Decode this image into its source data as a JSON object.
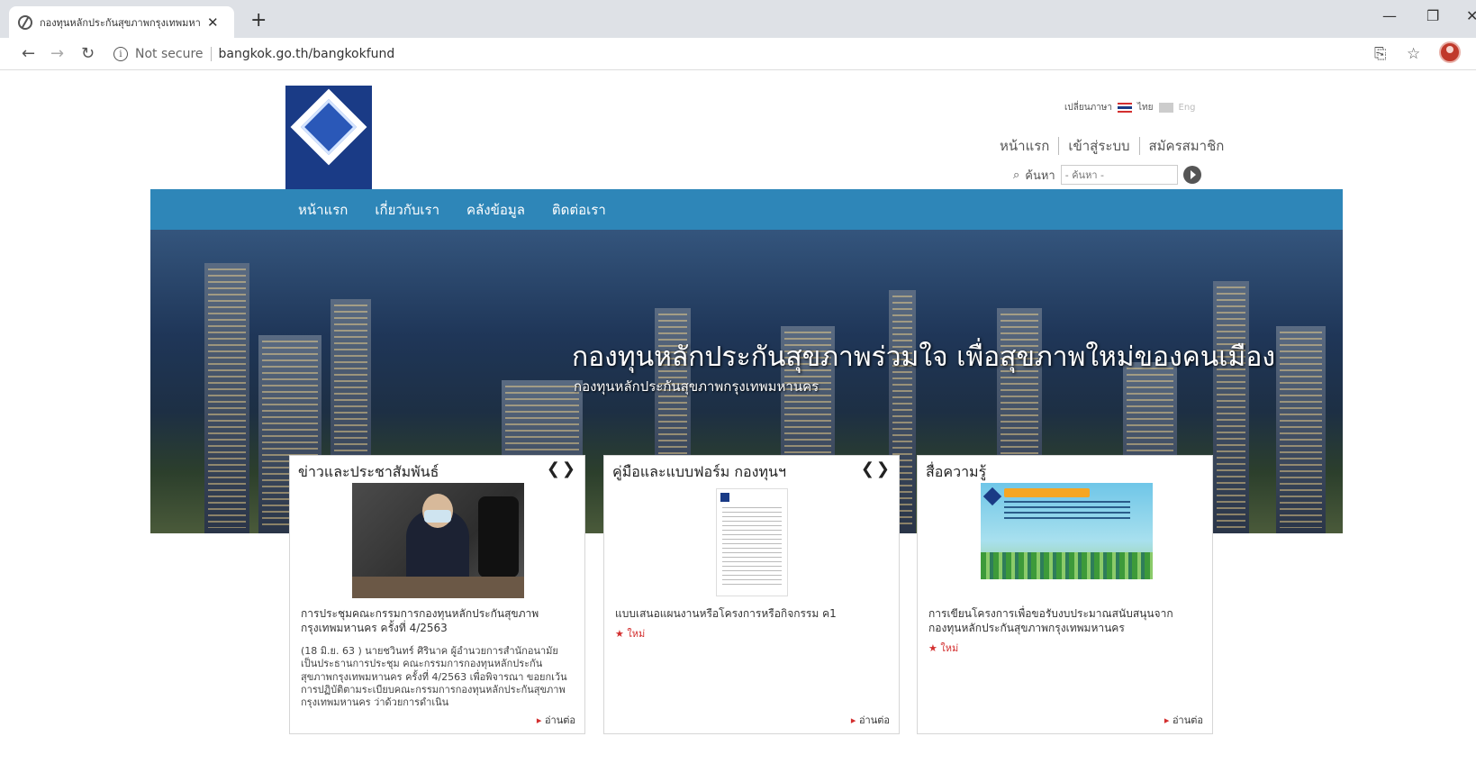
{
  "browser": {
    "tab_title": "กองทุนหลักประกันสุขภาพกรุงเทพมหา...",
    "not_secure": "Not secure",
    "url": "bangkok.go.th/bangkokfund"
  },
  "header": {
    "lang_label": "เปลี่ยนภาษา",
    "lang_th": "ไทย",
    "lang_en": "Eng",
    "top_links": [
      "หน้าแรก",
      "เข้าสู่ระบบ",
      "สมัครสมาชิก"
    ],
    "search_label": "ค้นหา",
    "search_placeholder": "- ค้นหา -"
  },
  "nav": [
    "หน้าแรก",
    "เกี่ยวกับเรา",
    "คลังข้อมูล",
    "ติดต่อเรา"
  ],
  "hero": {
    "title": "กองทุนหลักประกันสุขภาพร่วมใจ เพื่อสุขภาพใหม่ของคนเมือง",
    "subtitle": "กองทุนหลักประกันสุขภาพกรุงเทพมหานคร"
  },
  "cards": [
    {
      "title": "ข่าวและประชาสัมพันธ์",
      "headline": "การประชุมคณะกรรมการกองทุนหลักประกันสุขภาพกรุงเทพมหานคร ครั้งที่ 4/2563",
      "body": "(18 มิ.ย. 63 ) นายชวินทร์ ศิรินาค ผู้อำนวยการสำนักอนามัย เป็นประธานการประชุม คณะกรรมการกองทุนหลักประกันสุขภาพกรุงเทพมหานคร ครั้งที่ 4/2563 เพื่อพิจารณา ขอยกเว้นการปฏิบัติตามระเบียบคณะกรรมการกองทุนหลักประกันสุขภาพกรุงเทพมหานคร ว่าด้วยการดำเนิน",
      "readmore": "อ่านต่อ"
    },
    {
      "title": "คู่มือและแบบฟอร์ม กองทุนฯ",
      "headline": "แบบเสนอแผนงานหรือโครงการหรือกิจกรรม ค1",
      "badge": "★ ใหม่",
      "readmore": "อ่านต่อ"
    },
    {
      "title": "สื่อความรู้",
      "headline": "การเขียนโครงการเพื่อขอรับงบประมาณสนับสนุนจากกองทุนหลักประกันสุขภาพกรุงเทพมหานคร",
      "badge": "★ ใหม่",
      "readmore": "อ่านต่อ"
    }
  ]
}
